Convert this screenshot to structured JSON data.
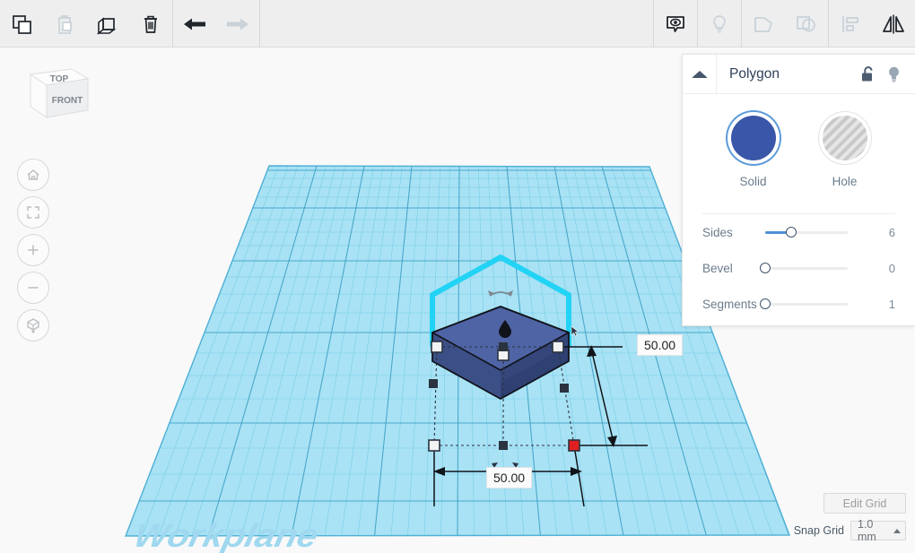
{
  "toolbar": {
    "left_buttons": [
      {
        "name": "copy-button",
        "icon": "copy-icon",
        "enabled": true,
        "label": "Copy"
      },
      {
        "name": "paste-button",
        "icon": "paste-icon",
        "enabled": false,
        "label": "Paste"
      },
      {
        "name": "duplicate-button",
        "icon": "duplicate-icon",
        "enabled": true,
        "label": "Duplicate"
      },
      {
        "name": "delete-button",
        "icon": "trash-icon",
        "enabled": true,
        "label": "Delete"
      }
    ],
    "history_buttons": [
      {
        "name": "undo-button",
        "icon": "undo-arrow-icon",
        "enabled": true,
        "label": "Undo"
      },
      {
        "name": "redo-button",
        "icon": "redo-arrow-icon",
        "enabled": false,
        "label": "Redo"
      }
    ],
    "right_buttons": [
      {
        "name": "show-hide-button",
        "icon": "eye-note-icon",
        "enabled": true,
        "label": "Show / Hide"
      },
      {
        "name": "light-button",
        "icon": "lightbulb-icon",
        "enabled": false,
        "label": "Light"
      },
      {
        "name": "group-button",
        "icon": "group-shapes-icon",
        "enabled": false,
        "label": "Group"
      },
      {
        "name": "ungroup-button",
        "icon": "ungroup-shapes-icon",
        "enabled": false,
        "label": "Ungroup"
      },
      {
        "name": "align-button",
        "icon": "align-icon",
        "enabled": false,
        "label": "Align"
      },
      {
        "name": "mirror-button",
        "icon": "mirror-icon",
        "enabled": true,
        "label": "Mirror"
      }
    ]
  },
  "viewcube": {
    "top_face_label": "TOP",
    "front_face_label": "FRONT"
  },
  "nav": {
    "buttons": [
      {
        "name": "home-view-button",
        "icon": "home-icon"
      },
      {
        "name": "fit-all-button",
        "icon": "fit-frame-icon"
      },
      {
        "name": "zoom-in-button",
        "icon": "plus-icon"
      },
      {
        "name": "zoom-out-button",
        "icon": "minus-icon"
      },
      {
        "name": "ortho-perspective-button",
        "icon": "cube-ortho-icon"
      }
    ]
  },
  "scene": {
    "workplane_label": "Workplane",
    "dimension_depth": "50.00",
    "dimension_width": "50.00",
    "shape_color": "#4b63ab",
    "shape_top_color": "#51659f",
    "highlight_color": "#22d3f5",
    "selected_handle_color": "#e02020"
  },
  "grid_controls": {
    "edit_grid_label": "Edit Grid",
    "snap_grid_label": "Snap Grid",
    "snap_grid_value": "1.0 mm"
  },
  "panel": {
    "title": "Polygon",
    "collapse_icon": "triangle-up-icon",
    "lock_icon": "unlocked-padlock-icon",
    "light_icon": "lightbulb-icon",
    "swatches": [
      {
        "name": "solid-swatch",
        "label": "Solid",
        "selected": true,
        "color": "#3a56a8"
      },
      {
        "name": "hole-swatch",
        "label": "Hole",
        "selected": false,
        "color": "#c9c9c9"
      }
    ],
    "sliders": [
      {
        "name": "sides-slider",
        "label": "Sides",
        "value": "6",
        "percent": 32
      },
      {
        "name": "bevel-slider",
        "label": "Bevel",
        "value": "0",
        "percent": 0
      },
      {
        "name": "segments-slider",
        "label": "Segments",
        "value": "1",
        "percent": 0
      }
    ]
  }
}
